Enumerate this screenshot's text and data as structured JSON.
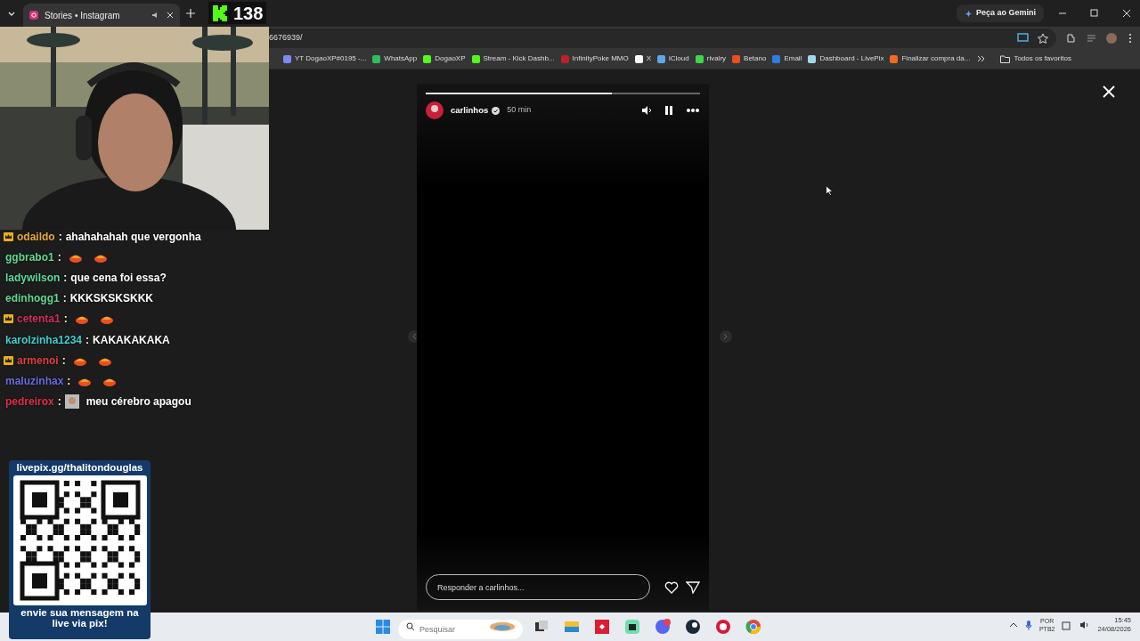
{
  "browser": {
    "tab": {
      "title": "Stories • Instagram",
      "selected": true
    },
    "gemini_button": "Peça ao Gemini",
    "address": "6676939/",
    "bookmarks": [
      {
        "label": "YT DogaoXP#0195 -...",
        "color": "#7b8cf0"
      },
      {
        "label": "WhatsApp",
        "color": "#2fbf5a"
      },
      {
        "label": "DogaoXP",
        "color": "#53fc18"
      },
      {
        "label": "Stream - Kick Dashb...",
        "color": "#53fc18"
      },
      {
        "label": "InfinityPoke MMO",
        "color": "#c0202a"
      },
      {
        "label": "X",
        "color": "#ffffff"
      },
      {
        "label": "iCloud",
        "color": "#5aa8e8"
      },
      {
        "label": "rivalry",
        "color": "#3ed84a"
      },
      {
        "label": "Betano",
        "color": "#e8501e"
      },
      {
        "label": "Email",
        "color": "#2f7de0"
      },
      {
        "label": "Dashboard - LivePix",
        "color": "#9fd8e8"
      },
      {
        "label": "Finalizar compra da...",
        "color": "#f06a20"
      }
    ],
    "all_bookmarks": "Todos os favoritos"
  },
  "stream_overlay": {
    "viewer_count": "138",
    "chat": [
      {
        "user": "odaildo",
        "color": "#e8a93a",
        "subscriber": true,
        "separator": ":",
        "kind": "text",
        "message": "ahahahahah que vergonha"
      },
      {
        "user": "ggbrabo1",
        "color": "#62d98f",
        "subscriber": false,
        "separator": ":",
        "kind": "emotes"
      },
      {
        "user": "ladywilson",
        "color": "#5fd9a0",
        "subscriber": false,
        "separator": ":",
        "kind": "text",
        "message": "que cena foi essa?"
      },
      {
        "user": "edinhogg1",
        "color": "#5fd98f",
        "subscriber": false,
        "separator": ":",
        "kind": "text",
        "message": "KKKSKSKSKKK"
      },
      {
        "user": "cetenta1",
        "color": "#d0305a",
        "subscriber": true,
        "separator": ":",
        "kind": "emotes"
      },
      {
        "user": "karolzinha1234",
        "color": "#3fd0d0",
        "subscriber": false,
        "separator": ":",
        "kind": "text",
        "message": "KAKAKAKAKA"
      },
      {
        "user": "armenoi",
        "color": "#e04040",
        "subscriber": true,
        "separator": ":",
        "kind": "emotes"
      },
      {
        "user": "maluzinhax",
        "color": "#6b6be0",
        "subscriber": false,
        "separator": ":",
        "kind": "emotes"
      },
      {
        "user": "pedreirox",
        "color": "#e0304a",
        "subscriber": false,
        "separator": ":",
        "kind": "image-text",
        "message": "meu cérebro apagou"
      }
    ],
    "qr": {
      "title": "livepix.gg/thalitondouglas",
      "caption": "envie sua mensagem na live via pix!"
    }
  },
  "story": {
    "user": "carlinhos",
    "verified": true,
    "time": "50 min",
    "progress": {
      "level": 0.68
    },
    "reply_placeholder": "Responder a carlinhos..."
  },
  "taskbar": {
    "search_placeholder": "Pesquisar",
    "language": "POR",
    "layout": "PTB2",
    "time": "15:45",
    "date": "24/08/2026"
  }
}
